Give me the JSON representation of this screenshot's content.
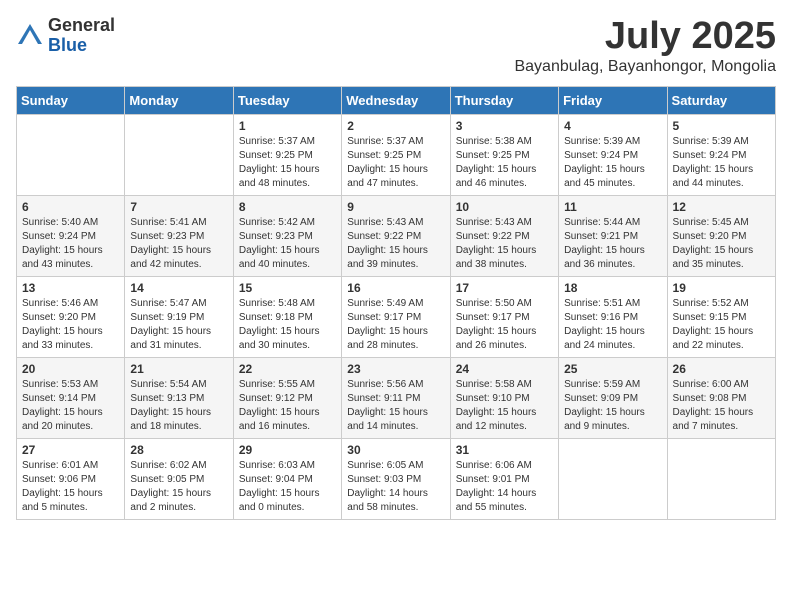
{
  "logo": {
    "general": "General",
    "blue": "Blue"
  },
  "title": {
    "month": "July 2025",
    "location": "Bayanbulag, Bayanhongor, Mongolia"
  },
  "weekdays": [
    "Sunday",
    "Monday",
    "Tuesday",
    "Wednesday",
    "Thursday",
    "Friday",
    "Saturday"
  ],
  "weeks": [
    [
      {
        "day": "",
        "sunrise": "",
        "sunset": "",
        "daylight": ""
      },
      {
        "day": "",
        "sunrise": "",
        "sunset": "",
        "daylight": ""
      },
      {
        "day": "1",
        "sunrise": "Sunrise: 5:37 AM",
        "sunset": "Sunset: 9:25 PM",
        "daylight": "Daylight: 15 hours and 48 minutes."
      },
      {
        "day": "2",
        "sunrise": "Sunrise: 5:37 AM",
        "sunset": "Sunset: 9:25 PM",
        "daylight": "Daylight: 15 hours and 47 minutes."
      },
      {
        "day": "3",
        "sunrise": "Sunrise: 5:38 AM",
        "sunset": "Sunset: 9:25 PM",
        "daylight": "Daylight: 15 hours and 46 minutes."
      },
      {
        "day": "4",
        "sunrise": "Sunrise: 5:39 AM",
        "sunset": "Sunset: 9:24 PM",
        "daylight": "Daylight: 15 hours and 45 minutes."
      },
      {
        "day": "5",
        "sunrise": "Sunrise: 5:39 AM",
        "sunset": "Sunset: 9:24 PM",
        "daylight": "Daylight: 15 hours and 44 minutes."
      }
    ],
    [
      {
        "day": "6",
        "sunrise": "Sunrise: 5:40 AM",
        "sunset": "Sunset: 9:24 PM",
        "daylight": "Daylight: 15 hours and 43 minutes."
      },
      {
        "day": "7",
        "sunrise": "Sunrise: 5:41 AM",
        "sunset": "Sunset: 9:23 PM",
        "daylight": "Daylight: 15 hours and 42 minutes."
      },
      {
        "day": "8",
        "sunrise": "Sunrise: 5:42 AM",
        "sunset": "Sunset: 9:23 PM",
        "daylight": "Daylight: 15 hours and 40 minutes."
      },
      {
        "day": "9",
        "sunrise": "Sunrise: 5:43 AM",
        "sunset": "Sunset: 9:22 PM",
        "daylight": "Daylight: 15 hours and 39 minutes."
      },
      {
        "day": "10",
        "sunrise": "Sunrise: 5:43 AM",
        "sunset": "Sunset: 9:22 PM",
        "daylight": "Daylight: 15 hours and 38 minutes."
      },
      {
        "day": "11",
        "sunrise": "Sunrise: 5:44 AM",
        "sunset": "Sunset: 9:21 PM",
        "daylight": "Daylight: 15 hours and 36 minutes."
      },
      {
        "day": "12",
        "sunrise": "Sunrise: 5:45 AM",
        "sunset": "Sunset: 9:20 PM",
        "daylight": "Daylight: 15 hours and 35 minutes."
      }
    ],
    [
      {
        "day": "13",
        "sunrise": "Sunrise: 5:46 AM",
        "sunset": "Sunset: 9:20 PM",
        "daylight": "Daylight: 15 hours and 33 minutes."
      },
      {
        "day": "14",
        "sunrise": "Sunrise: 5:47 AM",
        "sunset": "Sunset: 9:19 PM",
        "daylight": "Daylight: 15 hours and 31 minutes."
      },
      {
        "day": "15",
        "sunrise": "Sunrise: 5:48 AM",
        "sunset": "Sunset: 9:18 PM",
        "daylight": "Daylight: 15 hours and 30 minutes."
      },
      {
        "day": "16",
        "sunrise": "Sunrise: 5:49 AM",
        "sunset": "Sunset: 9:17 PM",
        "daylight": "Daylight: 15 hours and 28 minutes."
      },
      {
        "day": "17",
        "sunrise": "Sunrise: 5:50 AM",
        "sunset": "Sunset: 9:17 PM",
        "daylight": "Daylight: 15 hours and 26 minutes."
      },
      {
        "day": "18",
        "sunrise": "Sunrise: 5:51 AM",
        "sunset": "Sunset: 9:16 PM",
        "daylight": "Daylight: 15 hours and 24 minutes."
      },
      {
        "day": "19",
        "sunrise": "Sunrise: 5:52 AM",
        "sunset": "Sunset: 9:15 PM",
        "daylight": "Daylight: 15 hours and 22 minutes."
      }
    ],
    [
      {
        "day": "20",
        "sunrise": "Sunrise: 5:53 AM",
        "sunset": "Sunset: 9:14 PM",
        "daylight": "Daylight: 15 hours and 20 minutes."
      },
      {
        "day": "21",
        "sunrise": "Sunrise: 5:54 AM",
        "sunset": "Sunset: 9:13 PM",
        "daylight": "Daylight: 15 hours and 18 minutes."
      },
      {
        "day": "22",
        "sunrise": "Sunrise: 5:55 AM",
        "sunset": "Sunset: 9:12 PM",
        "daylight": "Daylight: 15 hours and 16 minutes."
      },
      {
        "day": "23",
        "sunrise": "Sunrise: 5:56 AM",
        "sunset": "Sunset: 9:11 PM",
        "daylight": "Daylight: 15 hours and 14 minutes."
      },
      {
        "day": "24",
        "sunrise": "Sunrise: 5:58 AM",
        "sunset": "Sunset: 9:10 PM",
        "daylight": "Daylight: 15 hours and 12 minutes."
      },
      {
        "day": "25",
        "sunrise": "Sunrise: 5:59 AM",
        "sunset": "Sunset: 9:09 PM",
        "daylight": "Daylight: 15 hours and 9 minutes."
      },
      {
        "day": "26",
        "sunrise": "Sunrise: 6:00 AM",
        "sunset": "Sunset: 9:08 PM",
        "daylight": "Daylight: 15 hours and 7 minutes."
      }
    ],
    [
      {
        "day": "27",
        "sunrise": "Sunrise: 6:01 AM",
        "sunset": "Sunset: 9:06 PM",
        "daylight": "Daylight: 15 hours and 5 minutes."
      },
      {
        "day": "28",
        "sunrise": "Sunrise: 6:02 AM",
        "sunset": "Sunset: 9:05 PM",
        "daylight": "Daylight: 15 hours and 2 minutes."
      },
      {
        "day": "29",
        "sunrise": "Sunrise: 6:03 AM",
        "sunset": "Sunset: 9:04 PM",
        "daylight": "Daylight: 15 hours and 0 minutes."
      },
      {
        "day": "30",
        "sunrise": "Sunrise: 6:05 AM",
        "sunset": "Sunset: 9:03 PM",
        "daylight": "Daylight: 14 hours and 58 minutes."
      },
      {
        "day": "31",
        "sunrise": "Sunrise: 6:06 AM",
        "sunset": "Sunset: 9:01 PM",
        "daylight": "Daylight: 14 hours and 55 minutes."
      },
      {
        "day": "",
        "sunrise": "",
        "sunset": "",
        "daylight": ""
      },
      {
        "day": "",
        "sunrise": "",
        "sunset": "",
        "daylight": ""
      }
    ]
  ]
}
